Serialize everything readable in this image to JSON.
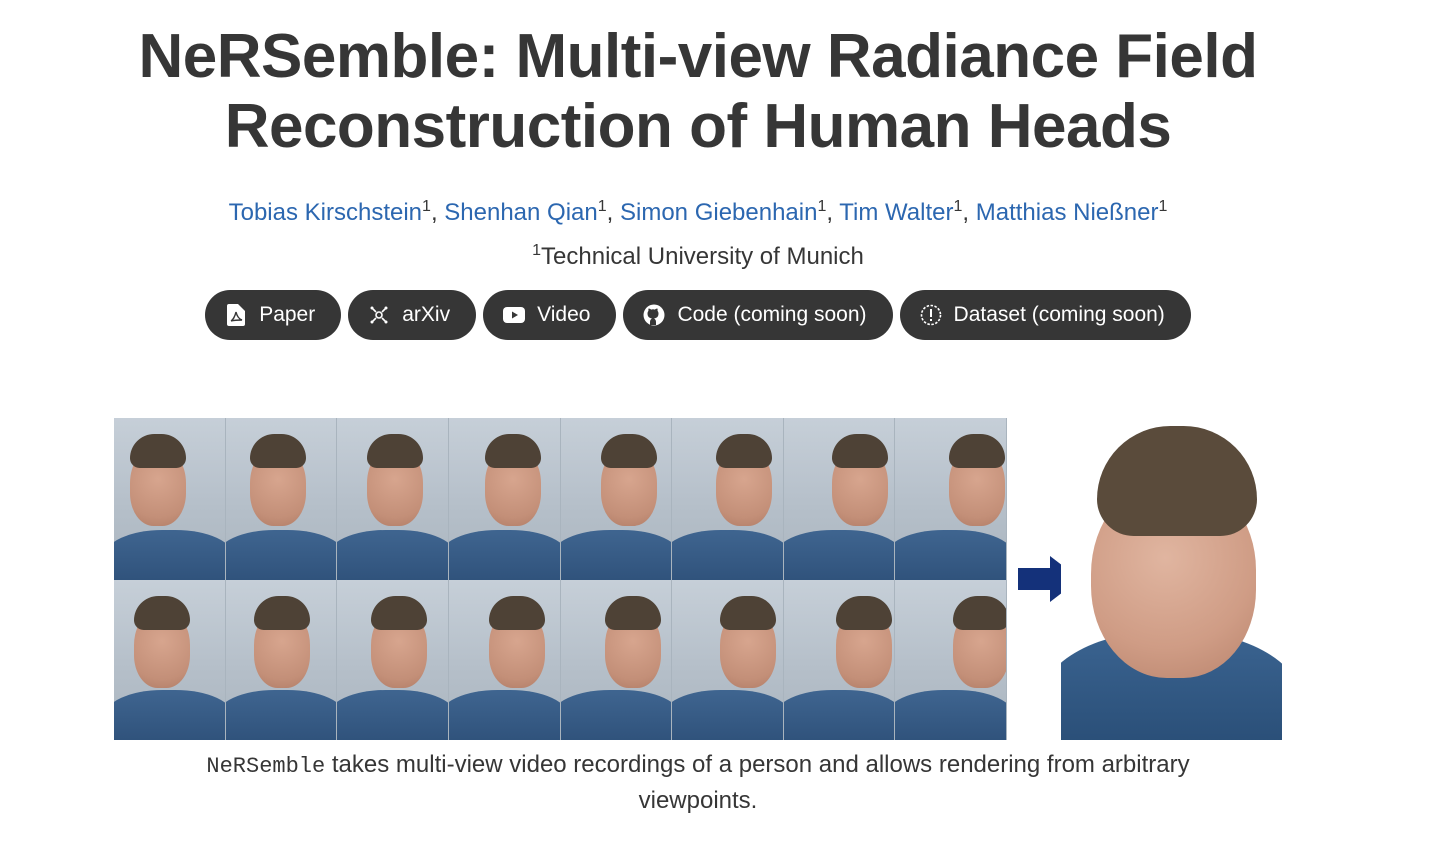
{
  "header": {
    "title_line1": "NeRSemble: Multi-view Radiance Field",
    "title_line2": "Reconstruction of Human Heads"
  },
  "authors": [
    {
      "name": "Tobias Kirschstein",
      "affil": "1"
    },
    {
      "name": "Shenhan Qian",
      "affil": "1"
    },
    {
      "name": "Simon Giebenhain",
      "affil": "1"
    },
    {
      "name": "Tim Walter",
      "affil": "1"
    },
    {
      "name": "Matthias Nießner",
      "affil": "1"
    }
  ],
  "separator": ",",
  "affiliation": {
    "marker": "1",
    "name": "Technical University of Munich"
  },
  "buttons": [
    {
      "label": "Paper",
      "icon": "pdf-icon"
    },
    {
      "label": "arXiv",
      "icon": "arxiv-icon"
    },
    {
      "label": "Video",
      "icon": "youtube-icon"
    },
    {
      "label": "Code (coming soon)",
      "icon": "github-icon"
    },
    {
      "label": "Dataset (coming soon)",
      "icon": "info-circle-icon"
    }
  ],
  "figure": {
    "grid_rows": 2,
    "grid_cols": 8,
    "arrow_color": "#14317a",
    "caption_code": "NeRSemble",
    "caption_text": " takes multi-view video recordings of a person and allows rendering from arbitrary viewpoints."
  },
  "colors": {
    "text": "#363636",
    "link": "#2c67b0",
    "button_bg": "#363636",
    "button_text": "#ffffff"
  }
}
